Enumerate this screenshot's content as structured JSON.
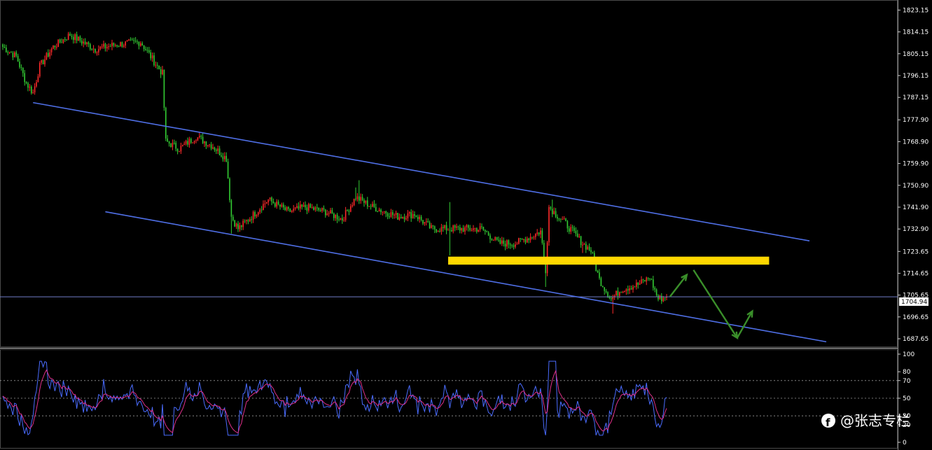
{
  "chart_data": [
    {
      "type": "candlestick",
      "title": "",
      "ylim": [
        1684.2,
        1827.3
      ],
      "y_ticks": [
        "1823.15",
        "1814.15",
        "1805.15",
        "1796.15",
        "1787.15",
        "1777.90",
        "1768.90",
        "1759.90",
        "1750.90",
        "1741.90",
        "1732.90",
        "1723.65",
        "1714.65",
        "1705.65",
        "1696.65",
        "1687.65"
      ],
      "current_price": "1704.94",
      "colors": {
        "up": "#ff2a2a",
        "down": "#33cc33",
        "channel": "#4f6fe6",
        "zone": "#ffd700",
        "arrow": "#3a8f2a",
        "price_line": "#6f7ec6"
      },
      "anchors": [
        {
          "i": 0,
          "p": 1808
        },
        {
          "i": 8,
          "p": 1804
        },
        {
          "i": 14,
          "p": 1793
        },
        {
          "i": 18,
          "p": 1789
        },
        {
          "i": 22,
          "p": 1800
        },
        {
          "i": 30,
          "p": 1808
        },
        {
          "i": 40,
          "p": 1813
        },
        {
          "i": 55,
          "p": 1807
        },
        {
          "i": 68,
          "p": 1809
        },
        {
          "i": 82,
          "p": 1810
        },
        {
          "i": 88,
          "p": 1804
        },
        {
          "i": 95,
          "p": 1797
        },
        {
          "i": 97,
          "p": 1769
        },
        {
          "i": 105,
          "p": 1766
        },
        {
          "i": 115,
          "p": 1771
        },
        {
          "i": 125,
          "p": 1767
        },
        {
          "i": 133,
          "p": 1762
        },
        {
          "i": 136,
          "p": 1738
        },
        {
          "i": 140,
          "p": 1733
        },
        {
          "i": 148,
          "p": 1738
        },
        {
          "i": 158,
          "p": 1745
        },
        {
          "i": 170,
          "p": 1740
        },
        {
          "i": 180,
          "p": 1742
        },
        {
          "i": 192,
          "p": 1740
        },
        {
          "i": 202,
          "p": 1737
        },
        {
          "i": 210,
          "p": 1746
        },
        {
          "i": 220,
          "p": 1742
        },
        {
          "i": 235,
          "p": 1738
        },
        {
          "i": 245,
          "p": 1739
        },
        {
          "i": 255,
          "p": 1733
        },
        {
          "i": 265,
          "p": 1733
        },
        {
          "i": 275,
          "p": 1733
        },
        {
          "i": 285,
          "p": 1733
        },
        {
          "i": 295,
          "p": 1727
        },
        {
          "i": 305,
          "p": 1727
        },
        {
          "i": 315,
          "p": 1730
        },
        {
          "i": 320,
          "p": 1732
        },
        {
          "i": 323,
          "p": 1716
        },
        {
          "i": 325,
          "p": 1742
        },
        {
          "i": 335,
          "p": 1735
        },
        {
          "i": 345,
          "p": 1727
        },
        {
          "i": 350,
          "p": 1724
        },
        {
          "i": 355,
          "p": 1712
        },
        {
          "i": 362,
          "p": 1704
        },
        {
          "i": 368,
          "p": 1708
        },
        {
          "i": 378,
          "p": 1710
        },
        {
          "i": 385,
          "p": 1713
        },
        {
          "i": 390,
          "p": 1704
        },
        {
          "i": 395,
          "p": 1705
        }
      ],
      "spikes": [
        {
          "i": 136,
          "low": 1731
        },
        {
          "i": 266,
          "high": 1744,
          "low": 1722
        },
        {
          "i": 210,
          "high": 1750
        },
        {
          "i": 323,
          "low": 1709
        },
        {
          "i": 327,
          "high": 1745
        },
        {
          "i": 363,
          "low": 1698
        },
        {
          "i": 345,
          "low": 1723
        },
        {
          "i": 212,
          "high": 1753
        }
      ],
      "channel": {
        "upper": {
          "from": {
            "i": 18,
            "p": 1785
          },
          "to": {
            "i": 480,
            "p": 1728
          }
        },
        "lower": {
          "from": {
            "i": 61,
            "p": 1740
          },
          "to": {
            "i": 490,
            "p": 1686.4
          }
        }
      },
      "zone": {
        "from_i": 265,
        "to_i": 456,
        "top": 1721.5,
        "bottom": 1718.2
      },
      "arrows": [
        [
          {
            "i": 397,
            "p": 1705
          },
          {
            "i": 407,
            "p": 1714
          }
        ],
        [
          {
            "i": 411,
            "p": 1716
          },
          {
            "i": 437,
            "p": 1688
          }
        ],
        [
          {
            "i": 437,
            "p": 1688
          },
          {
            "i": 446,
            "p": 1699
          }
        ]
      ]
    },
    {
      "type": "line",
      "title": "",
      "ylim": [
        0,
        100
      ],
      "y_ticks": [
        "100",
        "80",
        "70",
        "50",
        "30",
        "20",
        "0"
      ],
      "levels": [
        70,
        50,
        30
      ],
      "series": [
        {
          "color": "#4a6cff"
        },
        {
          "color": "#e0308a"
        }
      ]
    }
  ],
  "watermark": {
    "icon": "facebook-icon",
    "text": "@张志专栏"
  }
}
